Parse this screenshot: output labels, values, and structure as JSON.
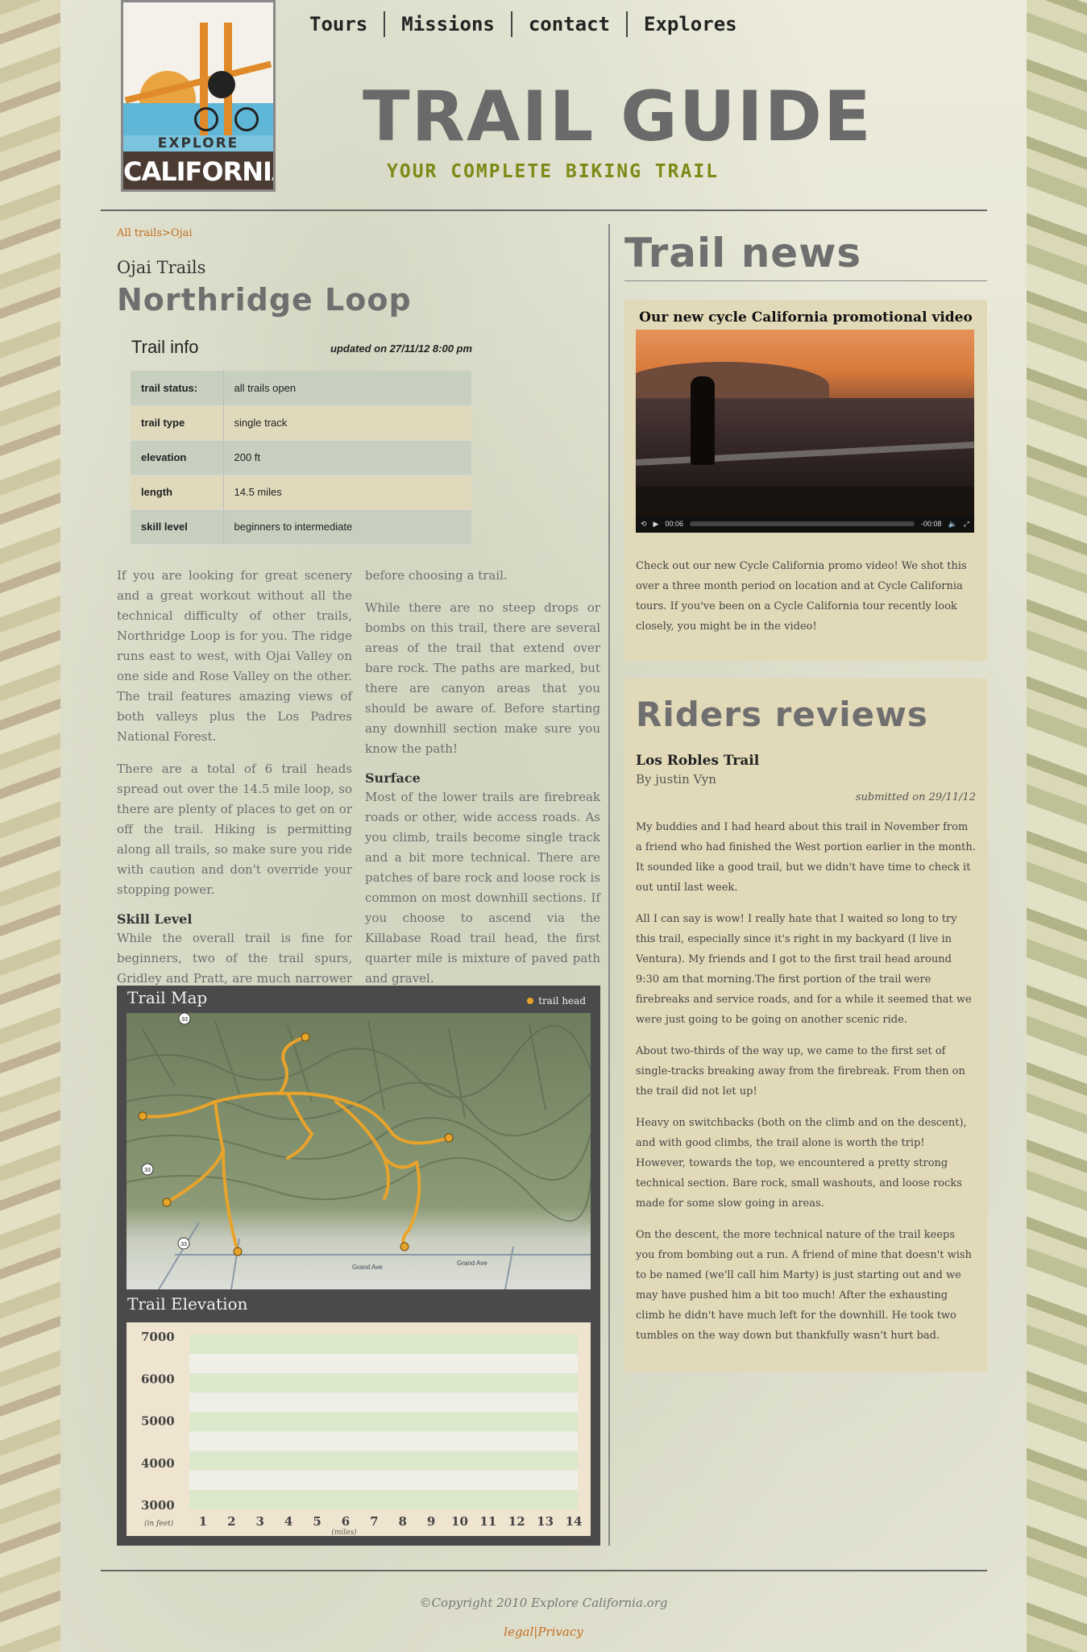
{
  "logo": {
    "top": "EXPLORE",
    "bottom": "CALIFORNIA"
  },
  "nav": [
    "Tours",
    "Missions",
    "contact",
    "Explores"
  ],
  "site": {
    "title": "TRAIL GUIDE",
    "subtitle": "YOUR COMPLETE BIKING TRAIL"
  },
  "breadcrumb": {
    "first": "All trails",
    "sep": ">",
    "second": "Ojai"
  },
  "subheading": "Ojai Trails",
  "trail_name": "Northridge Loop",
  "trail_info": {
    "title": "Trail info",
    "updated": "updated on 27/11/12 8:00 pm",
    "rows": [
      {
        "k": "trail status:",
        "v": "all trails open"
      },
      {
        "k": "trail type",
        "v": "single track"
      },
      {
        "k": "elevation",
        "v": "200 ft"
      },
      {
        "k": "length",
        "v": "14.5 miles"
      },
      {
        "k": "skill level",
        "v": "beginners to intermediate"
      }
    ]
  },
  "article": {
    "p1": "If you are looking for great scenery and a great workout without all the technical difficulty of other trails, Northridge Loop is for you. The ridge runs east to west, with Ojai Valley on one side and Rose Valley on the other. The trail features amazing views of both valleys plus the Los Padres National Forest.",
    "p2": "There are a total of 6 trail heads spread out over the 14.5 mile loop, so there are plenty of places to get on or off the trail. Hiking is permitting along all trails, so make sure you ride with caution and don't override your stopping power.",
    "skill_heading": "Skill Level",
    "p3": "While the overall trail is fine for beginners, two of the trail spurs, Gridley and Pratt, are much narrower and technical, so be sure to check the signage",
    "p3_end": "before choosing a trail.",
    "p4": "While there are no steep drops or bombs on this trail, there are several areas of the trail that extend over bare rock. The paths are marked, but there are canyon areas that you should be aware of. Before starting any downhill section make sure you know the path!",
    "surface_heading": "Surface",
    "p5": "Most of the lower trails are firebreak roads or other, wide access roads. As you climb, trails become single track and a bit more technical. There are patches of bare rock and loose rock is common on most downhill sections. If you choose to ascend via the Killabase Road trail head, the first quarter mile is mixture of paved path and gravel."
  },
  "map": {
    "title": "Trail Map",
    "legend": "trail head",
    "route_marker": "33",
    "road_name": "Grand Ave",
    "trail_color": "#e8a32b"
  },
  "elevation": {
    "title": "Trail Elevation",
    "y_ticks": [
      "7000",
      "6000",
      "5000",
      "4000",
      "3000"
    ],
    "x_ticks": [
      "1",
      "2",
      "3",
      "4",
      "5",
      "6",
      "7",
      "8",
      "9",
      "10",
      "11",
      "12",
      "13",
      "14"
    ],
    "y_unit": "(in feet)",
    "x_unit": "(miles)"
  },
  "news": {
    "title": "Trail news",
    "video_title": "Our new cycle California promotional video",
    "video_elapsed": "00:06",
    "video_remaining": "-00:08",
    "text": "Check out our new Cycle California promo video! We shot this over a three month period on location and at Cycle California tours. If you've been on a Cycle California tour recently look closely, you might be in the video!"
  },
  "reviews": {
    "title": "Riders reviews",
    "trail": "Los Robles Trail",
    "author": "By justin Vyn",
    "date": "submitted on 29/11/12",
    "paragraphs": [
      "My buddies and I had heard about this trail in November from a friend who had finished the West portion earlier in the month. It sounded like a good trail, but we didn't have time to check it out until last week.",
      "All I can say is wow! I really hate that I waited so long to try this trail, especially since it's right in my backyard (I live in Ventura). My friends and I got to the first trail head around 9:30 am that morning.The first portion of the trail were firebreaks and service roads, and for a while it seemed that we were just going to be going on another scenic ride.",
      "About two-thirds of the way up, we came to the first set of single-tracks breaking away from the firebreak. From then on the trail did not let up!",
      "Heavy on switchbacks (both on the climb and on the descent), and with good climbs, the trail alone is worth the trip! However, towards the top, we encountered a pretty strong technical section. Bare rock, small washouts, and loose rocks made for some slow going in areas.",
      "On the descent, the more technical nature of the trail keeps you from bombing out a run. A friend of mine that doesn't wish to be named (we'll call him Marty) is just starting out and we may have pushed him a bit too much! After the exhausting climb he didn't have much left for the downhill. He took two tumbles on the way down but thankfully wasn't hurt bad."
    ]
  },
  "footer": {
    "copyright": "©Copyright 2010 Explore California.org",
    "legal": "legal",
    "sep": "|",
    "privacy": "Privacy"
  }
}
